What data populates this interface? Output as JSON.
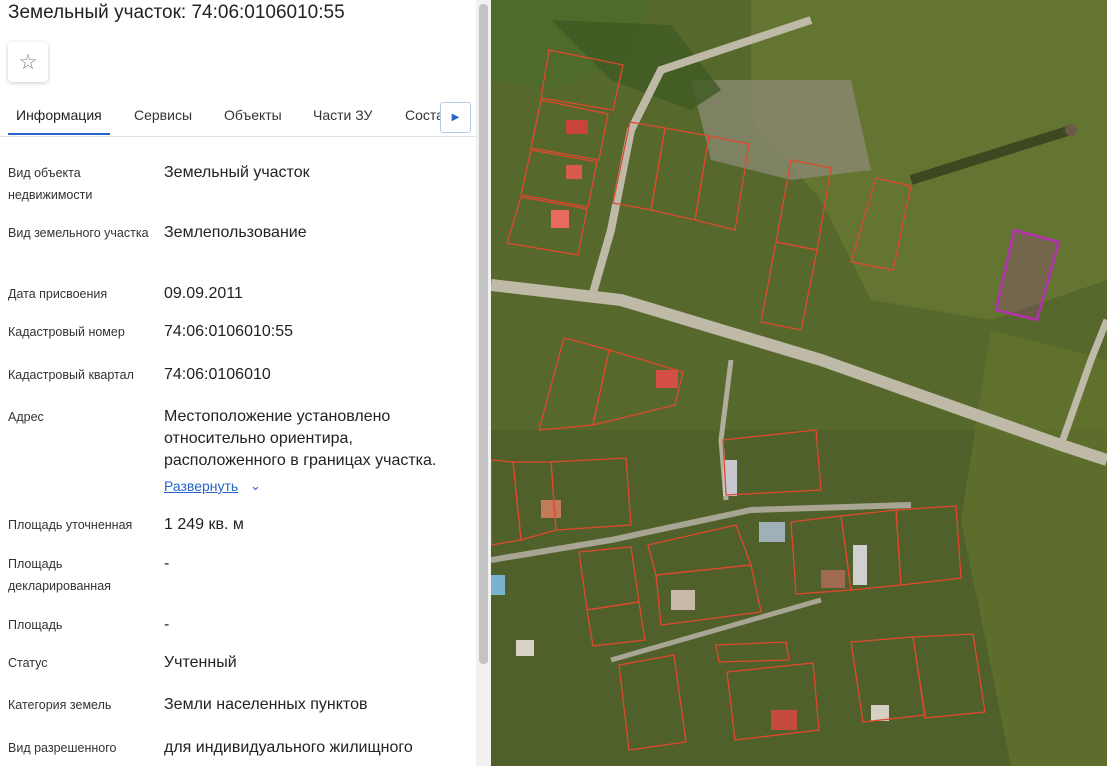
{
  "header": {
    "title": "Земельный участок: 74:06:0106010:55",
    "favorite_icon": "star-icon"
  },
  "tabs": [
    {
      "label": "Информация",
      "active": true
    },
    {
      "label": "Сервисы",
      "active": false
    },
    {
      "label": "Объекты",
      "active": false
    },
    {
      "label": "Части ЗУ",
      "active": false
    },
    {
      "label": "Соста",
      "active": false
    }
  ],
  "tabs_more_icon": "caret-right-icon",
  "fields": {
    "object_type": {
      "label": "Вид объекта недвижимости",
      "value": "Земельный участок"
    },
    "land_type": {
      "label": "Вид земельного участка",
      "value": "Землепользование"
    },
    "date": {
      "label": "Дата присвоения",
      "value": "09.09.2011"
    },
    "cadastral_number": {
      "label": "Кадастровый номер",
      "value": "74:06:0106010:55"
    },
    "cadastral_block": {
      "label": "Кадастровый квартал",
      "value": "74:06:0106010"
    },
    "address": {
      "label": "Адрес",
      "value": "Местоположение установлено относительно ориентира, расположенного в границах участка.",
      "expand_label": "Развернуть"
    },
    "area_precise": {
      "label": "Площадь уточненная",
      "value": "1 249 кв. м"
    },
    "area_declared": {
      "label": "Площадь декларированная",
      "value": "-"
    },
    "area": {
      "label": "Площадь",
      "value": "-"
    },
    "status": {
      "label": "Статус",
      "value": "Учтенный"
    },
    "land_category": {
      "label": "Категория земель",
      "value": "Земли населенных пунктов"
    },
    "permitted_use": {
      "label": "Вид разрешенного",
      "value": "для индивидуального жилищного"
    }
  },
  "map": {
    "type": "satellite",
    "colors": {
      "parcel_outline": "#e0482d",
      "selected_parcel": "#b52fb0",
      "road": "#bfb9a8",
      "vegetation": "#57682d"
    }
  }
}
